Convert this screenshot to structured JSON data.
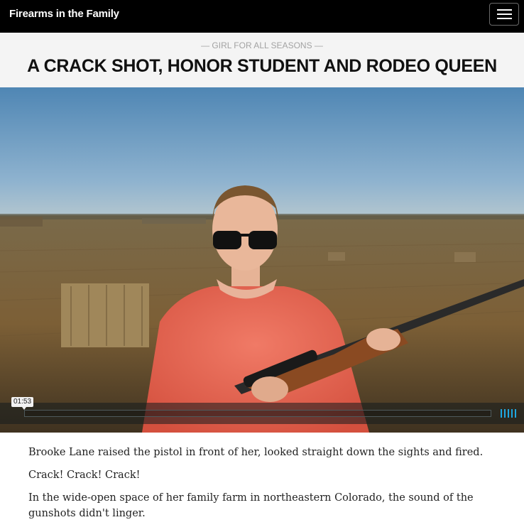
{
  "topbar": {
    "site_title": "Firearms in the Family",
    "menu_icon": "hamburger-menu-icon"
  },
  "header": {
    "kicker": "— GIRL FOR ALL SEASONS —",
    "headline": "A CRACK SHOT, HONOR STUDENT AND RODEO QUEEN"
  },
  "video": {
    "time": "01:53",
    "progress": 0,
    "volume_icon": "volume-bars-icon",
    "colors": {
      "accent": "#1ea7e1",
      "sky": "#5b8fb8",
      "field": "#8a6a3e",
      "shirt": "#e8604f"
    }
  },
  "article": {
    "paragraphs": [
      "Brooke Lane raised the pistol in front of her, looked straight down the sights and fired.",
      "Crack! Crack! Crack!",
      "In the wide-open space of her family farm in northeastern Colorado, the sound of the gunshots didn't linger."
    ]
  }
}
